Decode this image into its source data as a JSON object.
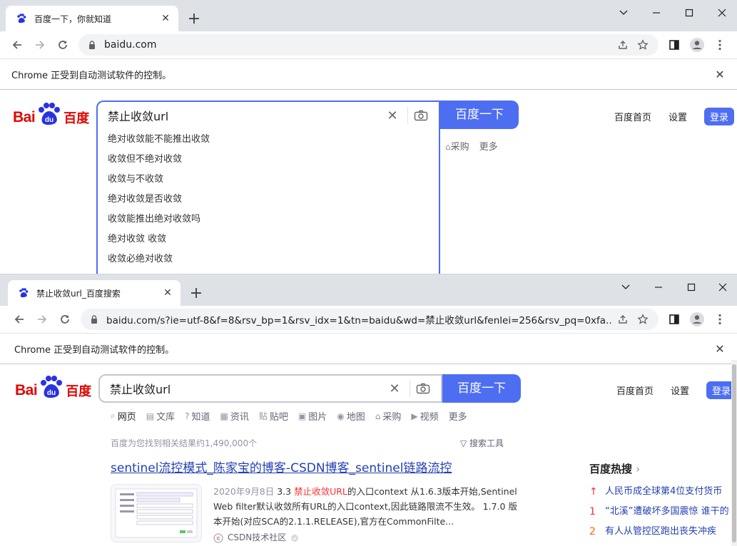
{
  "window1": {
    "tab_title": "百度一下，你就知道",
    "url": "baidu.com",
    "infobar": "Chrome 正受到自动测试软件的控制。",
    "logo": {
      "text": "Bai",
      "badge": "du",
      "cn": "百度"
    },
    "search": {
      "query": "禁止收敛url",
      "button": "百度一下"
    },
    "nav": {
      "home": "百度首页",
      "settings": "设置",
      "login": "登录"
    },
    "suggestions": [
      "绝对收敛能不能推出收敛",
      "收敛但不绝对收敛",
      "收敛与不收敛",
      "绝对收敛是否收敛",
      "收敛能推出绝对收敛吗",
      "绝对收敛 收敛",
      "收敛必绝对收敛"
    ],
    "side_links": [
      "采购",
      "更多"
    ]
  },
  "window2": {
    "tab_title": "禁止收敛url_百度搜索",
    "url": "baidu.com/s?ie=utf-8&f=8&rsv_bp=1&rsv_idx=1&tn=baidu&wd=禁止收敛url&fenlei=256&rsv_pq=0xfa...",
    "infobar": "Chrome 正受到自动测试软件的控制。",
    "logo": {
      "text": "Bai",
      "badge": "du",
      "cn": "百度"
    },
    "search": {
      "query": "禁止收敛url",
      "button": "百度一下"
    },
    "nav": {
      "home": "百度首页",
      "settings": "设置",
      "login": "登录"
    },
    "tabs": [
      "网页",
      "文库",
      "知道",
      "资讯",
      "贴吧",
      "图片",
      "地图",
      "采购",
      "视频",
      "更多"
    ],
    "result_count": "百度为您找到相关结果约1,490,000个",
    "search_tools": "搜索工具",
    "result": {
      "title": "sentinel流控模式_陈家宝的博客-CSDN博客_sentinel链路流控",
      "date": "2020年9月8日",
      "snippet_pre": "3.3 ",
      "snippet_hl": "禁止收敛URL",
      "snippet_post": "的入口context 从1.6.3版本开始,Sentinel Web filter默认收敛所有URL的入口context,因此链路限流不生效。 1.7.0 版本开始(对应SCA的2.1.1.RELEASE),官方在CommonFilte...",
      "source": "CSDN技术社区"
    },
    "hot": {
      "title": "百度热搜",
      "items": [
        {
          "rank": "↑",
          "text": "人民币成全球第4位支付货币"
        },
        {
          "rank": "1",
          "text": "“北溪”遭破坏多国震惊 谁干的"
        },
        {
          "rank": "2",
          "text": "有人从管控区跑出丧失冲疾"
        }
      ]
    }
  },
  "colors": {
    "brand_blue": "#4e6ef2",
    "brand_red": "#e10602",
    "link": "#2440b3",
    "highlight": "#f73131"
  }
}
